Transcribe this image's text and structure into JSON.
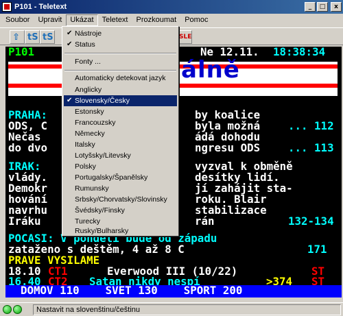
{
  "window": {
    "title": "P101 - Teletext",
    "min": "_",
    "max": "□",
    "close": "x"
  },
  "menubar": [
    "Soubor",
    "Upravit",
    "Ukázat",
    "Teletext",
    "Prozkoumat",
    "Pomoc"
  ],
  "toolbar": {
    "b2": "tS",
    "b3": "tS",
    "b4": "SLE"
  },
  "teletext": {
    "header_page": "P101",
    "header_date": "Ne 12.11.",
    "header_time": "18:38:34",
    "headline": "álně",
    "rows": [
      {
        "text": "PRAHA:",
        "color": "cyan"
      },
      {
        "text": "ODS, C",
        "color": "white"
      },
      {
        "text": "Nečas",
        "color": "white"
      },
      {
        "text": "do dvo",
        "color": "white"
      },
      {
        "text": "IRAK:",
        "color": "cyan"
      },
      {
        "text": "vlády.",
        "color": "white"
      },
      {
        "text": "Demokr",
        "color": "white"
      },
      {
        "text": "hování",
        "color": "white"
      },
      {
        "text": "navrhu",
        "color": "white"
      },
      {
        "text": "Iráku",
        "color": "white"
      }
    ],
    "right_rows": [
      {
        "text": "by koalice",
        "color": "white"
      },
      {
        "text": "byla možná",
        "color": "white",
        "tail": "... 112",
        "tail_color": "cyan"
      },
      {
        "text": "ádá dohodu",
        "color": "white"
      },
      {
        "text": "ngresu ODS",
        "color": "white",
        "tail": "... 113",
        "tail_color": "cyan"
      },
      {
        "text": "vyzval k obměně",
        "color": "white"
      },
      {
        "text": "desítky lidí.",
        "color": "white"
      },
      {
        "text": "jí zahájit sta-",
        "color": "white"
      },
      {
        "text": "roku. Blair",
        "color": "white"
      },
      {
        "text": "stabilizace",
        "color": "white"
      },
      {
        "text": "rán",
        "color": "white",
        "tail": "132-134",
        "tail_color": "cyan"
      }
    ],
    "pocasi_1": "POCASI: V pondělí bude od západu",
    "pocasi_2": "zataženo s deštěm, 4 až 8 C",
    "pocasi_2_tail": "171",
    "prave": "PRAVE VYSILAME",
    "prog1_time": "18.10",
    "prog1_ch": "CT1",
    "prog1_title": "Everwood III (10/22)",
    "prog1_st": "ST",
    "prog2_time": "16.40",
    "prog2_ch": "CT2",
    "prog2_title": "Satan nikdy nespí",
    "prog2_page": ">374",
    "prog2_st": "ST",
    "nav": "DOMOV 110    SVET 130    SPORT 200"
  },
  "dropdown": {
    "items_top": [
      {
        "label": "Nástroje",
        "checked": true
      },
      {
        "label": "Status",
        "checked": true
      }
    ],
    "fonts": "Fonty ...",
    "auto_detect": "Automaticky detekovat jazyk",
    "languages": [
      "Anglicky",
      "Slovensky/Česky",
      "Estonsky",
      "Francouzsky",
      "Německy",
      "Italsky",
      "Lotyšsky/Litevsky",
      "Polsky",
      "Portugalsky/Španělsky",
      "Rumunsky",
      "Srbsky/Chorvatsky/Slovinsky",
      "Švédsky/Finsky",
      "Turecky",
      "Rusky/Bulharsky"
    ],
    "selected_language": "Slovensky/Česky"
  },
  "status": {
    "text": "Nastavit na slovenštinu/češtinu"
  }
}
